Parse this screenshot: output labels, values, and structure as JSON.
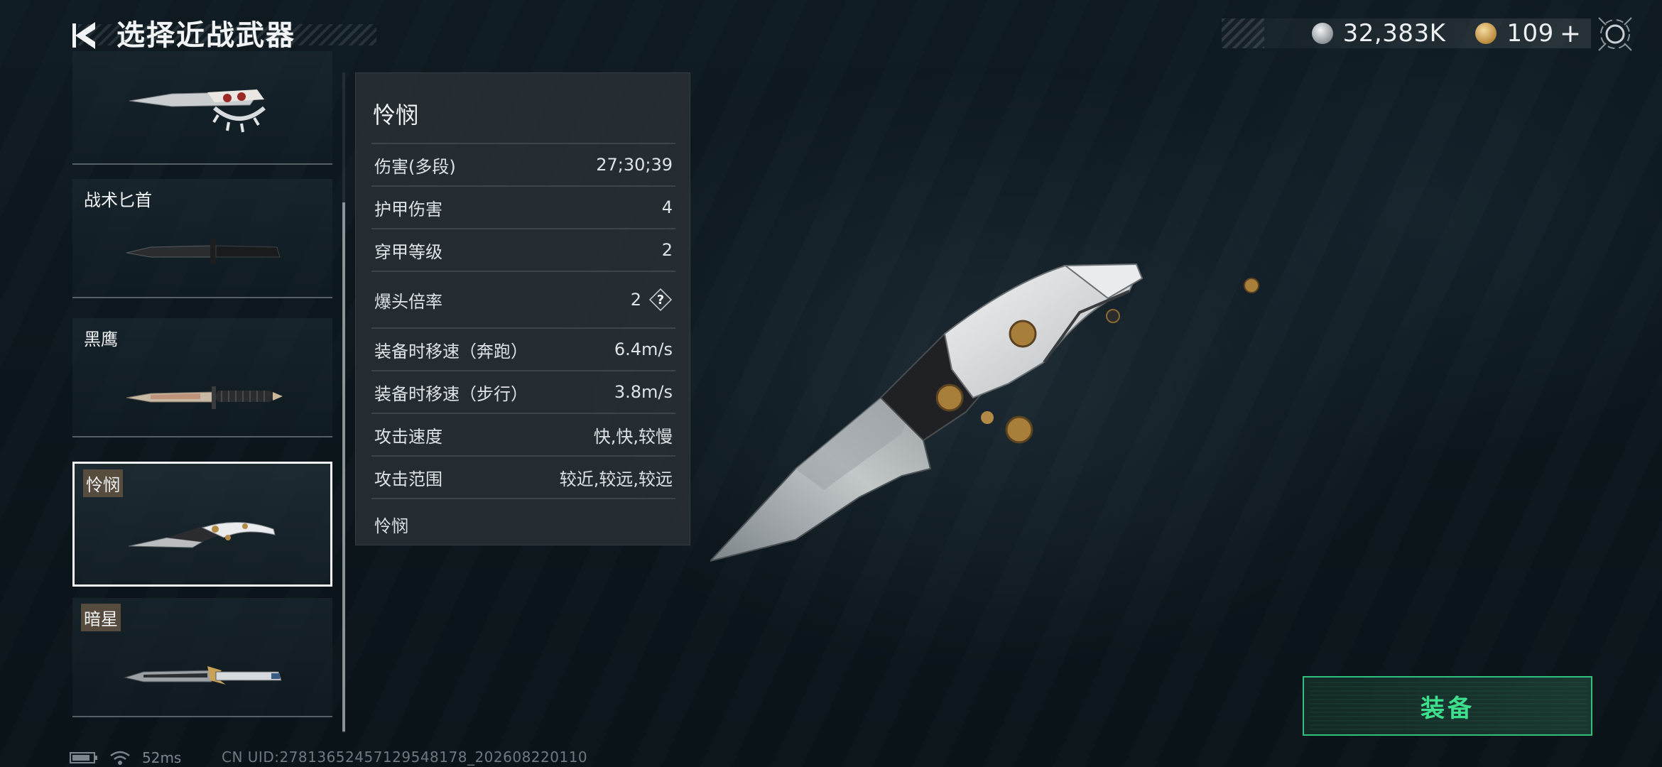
{
  "header": {
    "title": "选择近战武器",
    "silver_value": "32,383K",
    "gold_value": "109",
    "plus": "+"
  },
  "weapons": [
    {
      "name": ""
    },
    {
      "name": "战术匕首"
    },
    {
      "name": "黑鹰"
    },
    {
      "name": "怜悯"
    },
    {
      "name": "暗星"
    }
  ],
  "stats": {
    "title": "怜悯",
    "rows": [
      {
        "label": "伤害(多段)",
        "value": "27;30;39"
      },
      {
        "label": "护甲伤害",
        "value": "4"
      },
      {
        "label": "穿甲等级",
        "value": "2"
      },
      {
        "label": "爆头倍率",
        "value": "2"
      },
      {
        "label": "装备时移速（奔跑）",
        "value": "6.4m/s"
      },
      {
        "label": "装备时移速（步行）",
        "value": "3.8m/s"
      },
      {
        "label": "攻击速度",
        "value": "快,快,较慢"
      },
      {
        "label": "攻击范围",
        "value": "较近,较远,较远"
      }
    ],
    "description": "怜悯",
    "help_glyph": "?"
  },
  "equip_label": "装备",
  "footer": {
    "ping": "52ms",
    "uid": "CN UID:27813652457129548178_202608220110"
  },
  "icons": {
    "back": "back-arrow-icon",
    "silver": "silver-coin-icon",
    "gold": "gold-coin-icon",
    "settings": "settings-icon",
    "battery": "battery-icon",
    "wifi": "wifi-icon",
    "help": "help-icon"
  },
  "colors": {
    "accent_green": "#3ee08d",
    "selected_border": "#f2f4f5",
    "tag_bg": "#625442"
  }
}
